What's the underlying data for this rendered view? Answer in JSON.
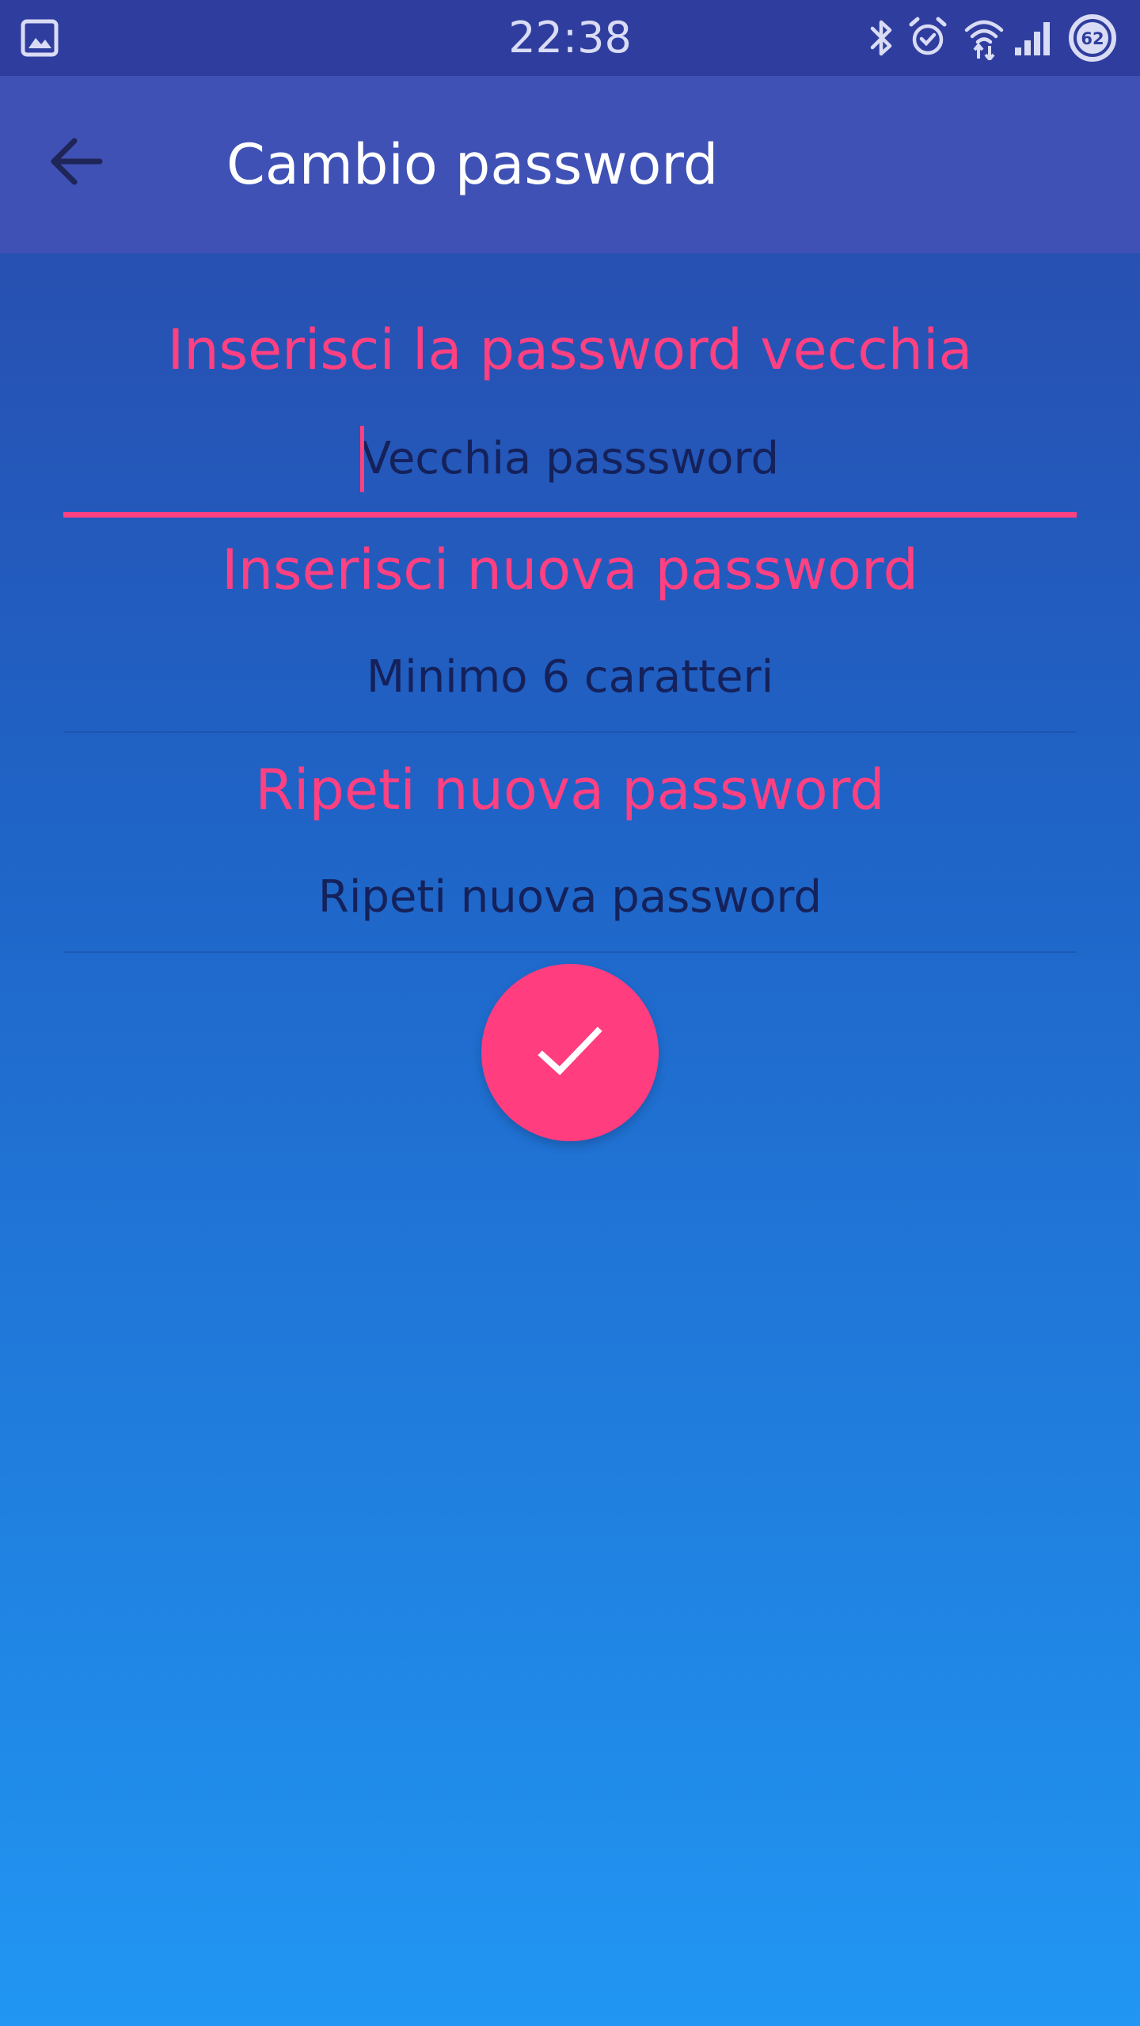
{
  "status_bar": {
    "time": "22:38",
    "battery_level": "62",
    "icons": [
      "gallery-icon",
      "bluetooth-icon",
      "alarm-icon",
      "wifi-icon",
      "signal-icon",
      "battery-icon"
    ]
  },
  "app_bar": {
    "title": "Cambio password",
    "back_icon": "arrow-back-icon"
  },
  "form": {
    "old_password": {
      "label": "Inserisci la password vecchia",
      "placeholder": "Vecchia passsword",
      "value": ""
    },
    "new_password": {
      "label": "Inserisci nuova password",
      "placeholder": "Minimo 6 caratteri",
      "value": ""
    },
    "repeat_password": {
      "label": "Ripeti nuova password",
      "placeholder": "Ripeti nuova password",
      "value": ""
    },
    "confirm_icon": "check-icon"
  },
  "colors": {
    "status_bar": "#2f3e9e",
    "app_bar": "#3f51b5",
    "accent": "#ff4081",
    "hint_text": "#15215a",
    "gradient_top": "#2b48a8",
    "gradient_bottom": "#2196f3"
  }
}
